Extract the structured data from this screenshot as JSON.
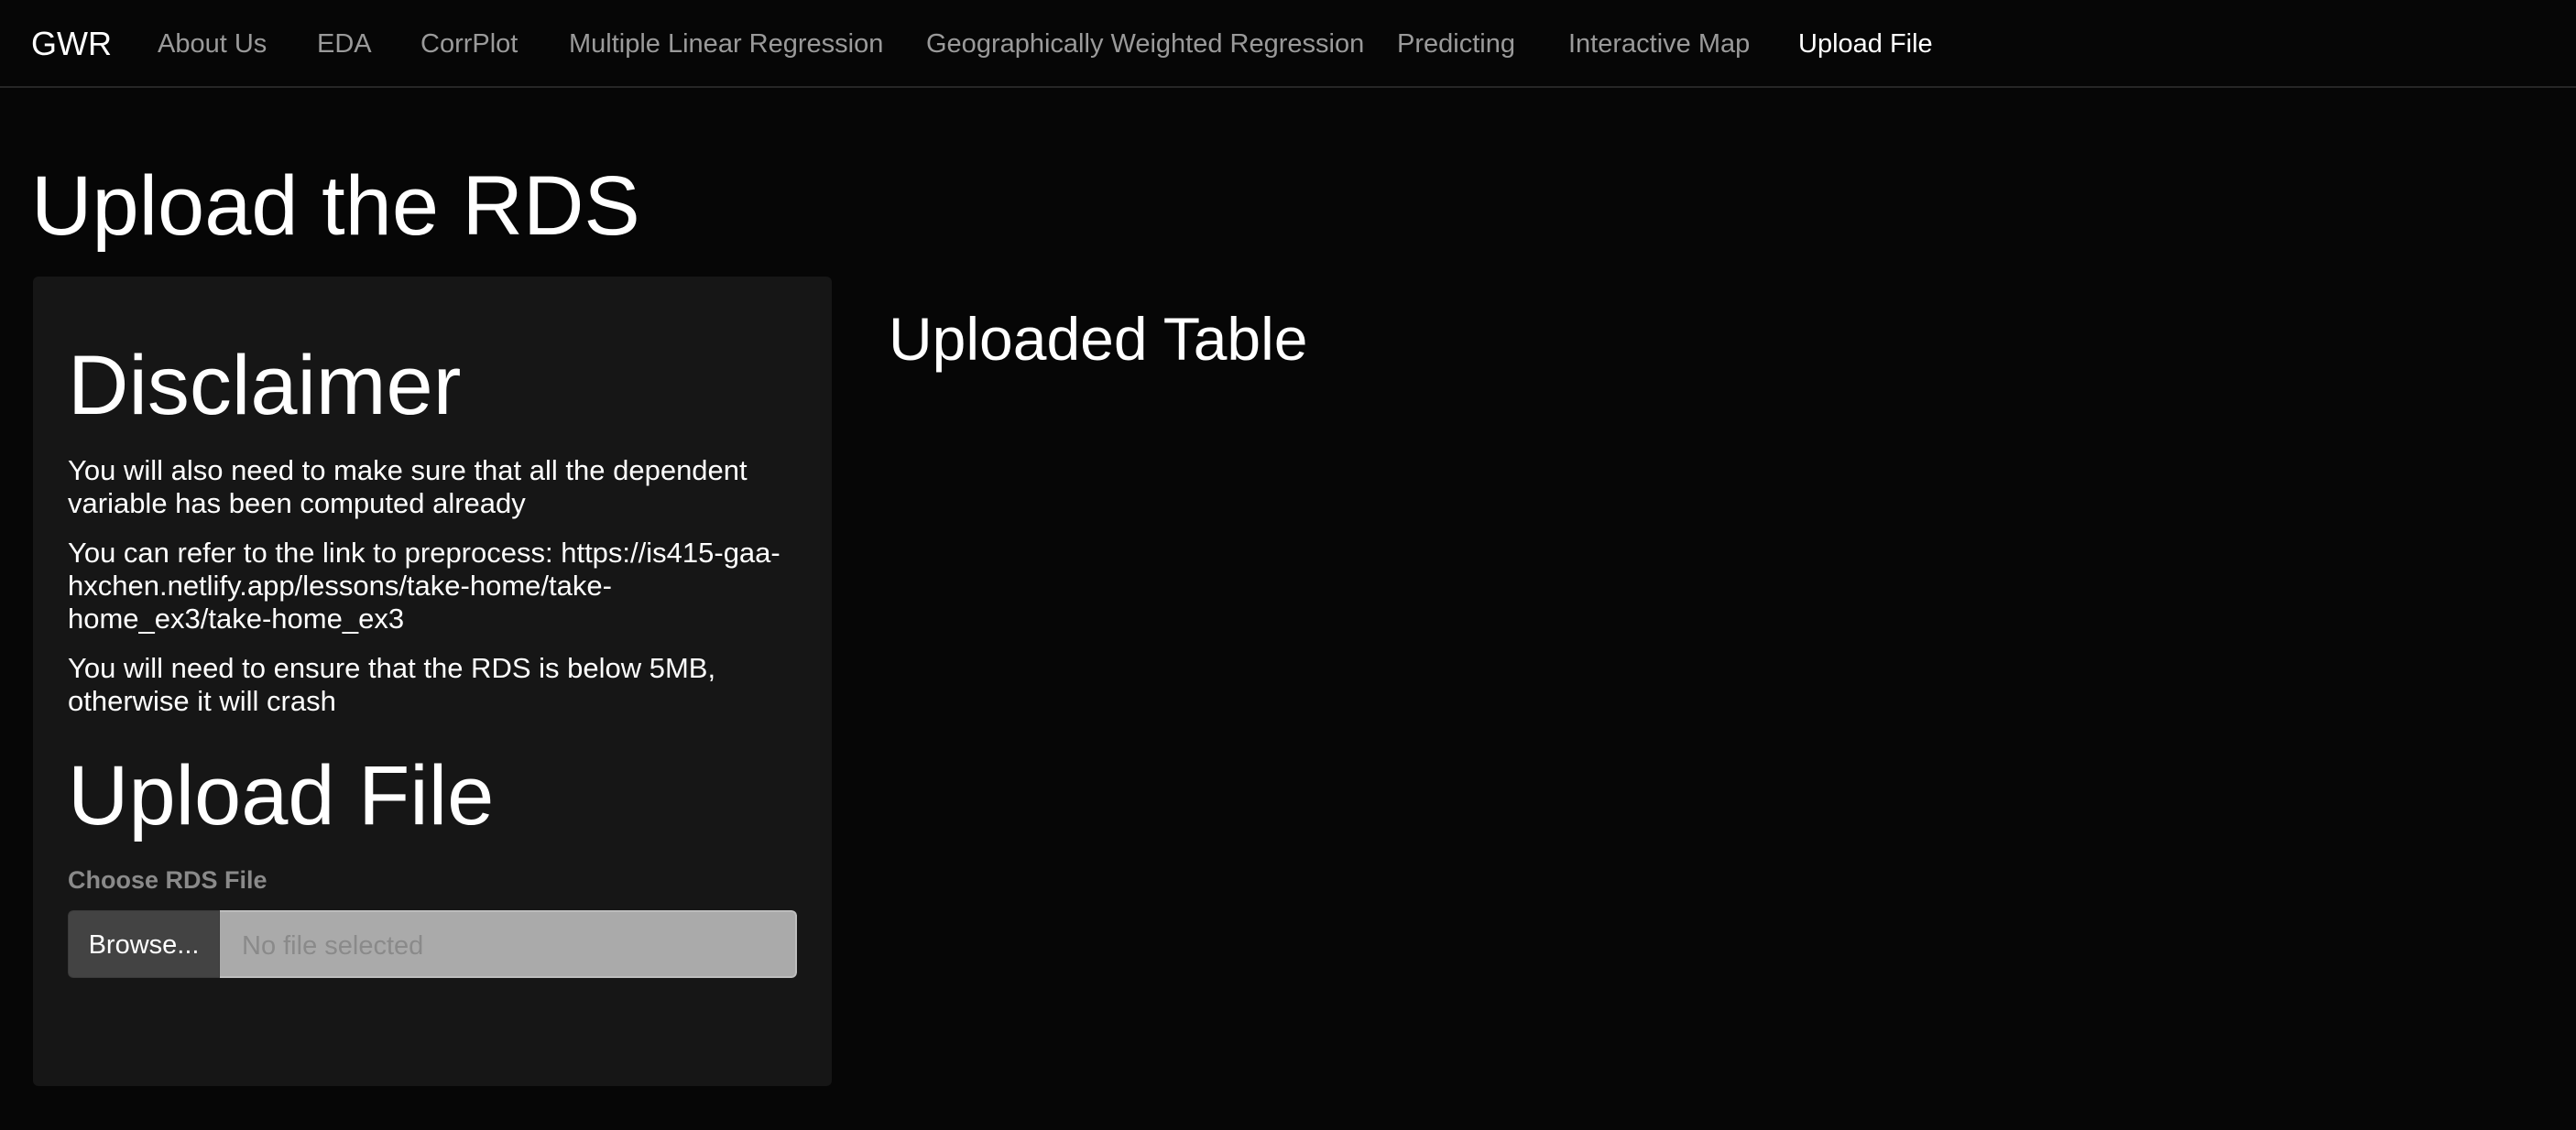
{
  "navbar": {
    "brand": "GWR",
    "items": [
      {
        "label": "About Us",
        "active": false
      },
      {
        "label": "EDA",
        "active": false
      },
      {
        "label": "CorrPlot",
        "active": false
      },
      {
        "label": "Multiple Linear Regression",
        "active": false
      },
      {
        "label": "Geographically Weighted Regression",
        "active": false
      },
      {
        "label": "Predicting",
        "active": false
      },
      {
        "label": "Interactive Map",
        "active": false
      },
      {
        "label": "Upload File",
        "active": true
      }
    ]
  },
  "page": {
    "title": "Upload the RDS"
  },
  "sidebar": {
    "disclaimer_heading": "Disclaimer",
    "paragraphs": [
      "You will also need to make sure that all the dependent variable has been computed already",
      "You can refer to the link to preprocess: https://is415-gaa-hxchen.netlify.app/lessons/take-home/take-home_ex3/take-home_ex3",
      "You will need to ensure that the RDS is below 5MB, otherwise it will crash"
    ],
    "upload_heading": "Upload File",
    "file_input": {
      "label": "Choose RDS File",
      "browse_label": "Browse...",
      "placeholder": "No file selected"
    }
  },
  "main": {
    "uploaded_title": "Uploaded Table"
  }
}
